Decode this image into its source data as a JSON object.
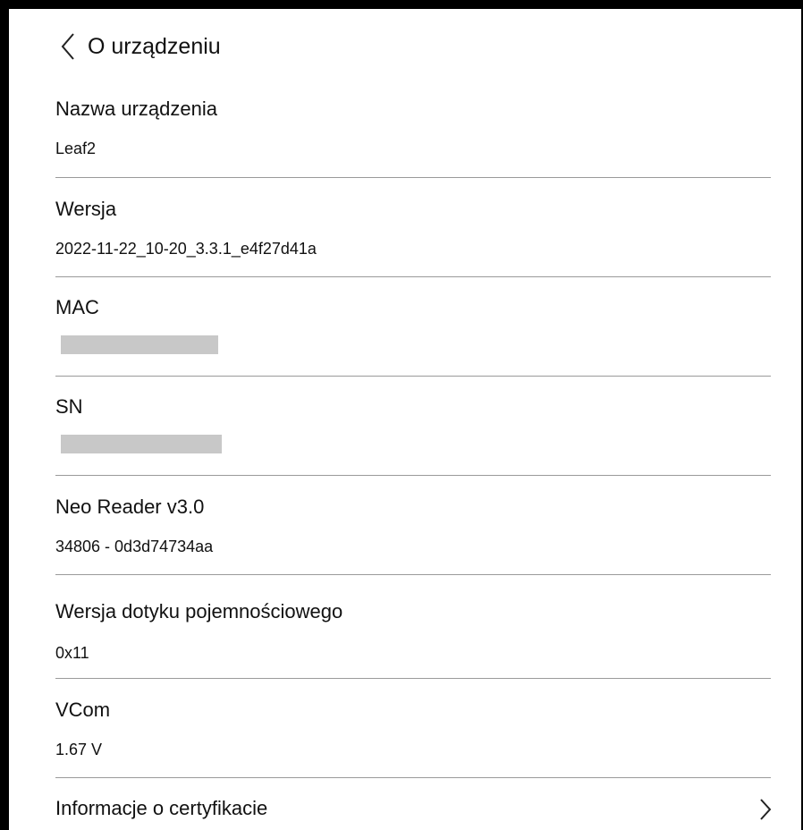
{
  "header": {
    "back_icon": "chevron-left-icon",
    "title": "O urządzeniu"
  },
  "rows": [
    {
      "label": "Nazwa urządzenia",
      "value": "Leaf2"
    },
    {
      "label": "Wersja",
      "value": "2022-11-22_10-20_3.3.1_e4f27d41a"
    },
    {
      "label": "MAC",
      "value": "",
      "redacted": true
    },
    {
      "label": "SN",
      "value": "",
      "redacted": true
    },
    {
      "label": "Neo Reader v3.0",
      "value": "34806 - 0d3d74734aa"
    },
    {
      "label": "Wersja dotyku pojemnościowego",
      "value": "0x11"
    },
    {
      "label": "VCom",
      "value": "1.67 V"
    }
  ],
  "nav_item": {
    "label": "Informacje o certyfikacie",
    "icon": "chevron-right-icon"
  },
  "colors": {
    "frame": "#000000",
    "background": "#ffffff",
    "text": "#111111",
    "divider": "#9a9a9a",
    "redaction": "#c8c8c8"
  }
}
